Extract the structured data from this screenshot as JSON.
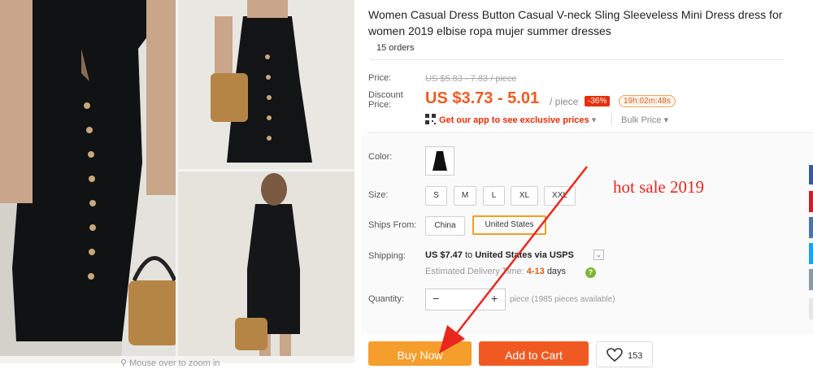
{
  "gallery": {
    "zoom_hint": "Mouse over to zoom in"
  },
  "product": {
    "title": "Women Casual Dress Button Casual V-neck Sling Sleeveless Mini Dress dress for women 2019 elbise ropa mujer summer dresses",
    "orders": "15 orders"
  },
  "price": {
    "label": "Price:",
    "original": "US $5.83 - 7.83 / piece",
    "discount_label_1": "Discount",
    "discount_label_2": "Price:",
    "current": "US $3.73 - 5.01",
    "unit": "/ piece",
    "discount_badge": "-36%",
    "countdown": "19h:02m:48s",
    "app_promo": "Get our app to see exclusive prices",
    "bulk_price": "Bulk Price"
  },
  "options": {
    "color_label": "Color:",
    "size_label": "Size:",
    "sizes": [
      "S",
      "M",
      "L",
      "XL",
      "XXL"
    ],
    "ships_from_label": "Ships From:",
    "ships_from": [
      "China",
      "United States"
    ],
    "ships_from_selected": "United States",
    "shipping_label": "Shipping:",
    "shipping_price": "US $7.47",
    "shipping_to": "to",
    "shipping_dest": "United States",
    "shipping_via": "via USPS",
    "delivery_label": "Estimated Delivery Time:",
    "delivery_days": "4-13",
    "delivery_unit": "days",
    "quantity_label": "Quantity:",
    "qty_minus": "−",
    "qty_plus": "+",
    "availability": "piece (1985 pieces available)"
  },
  "actions": {
    "buy_now": "Buy Now",
    "add_to_cart": "Add to Cart",
    "wishlist_count": "153"
  },
  "annotation": {
    "text": "hot sale 2019",
    "color": "#e8281e"
  },
  "colors": {
    "accent": "#f05a22",
    "buy_button": "#f59e2b",
    "badge": "#e62e04"
  }
}
